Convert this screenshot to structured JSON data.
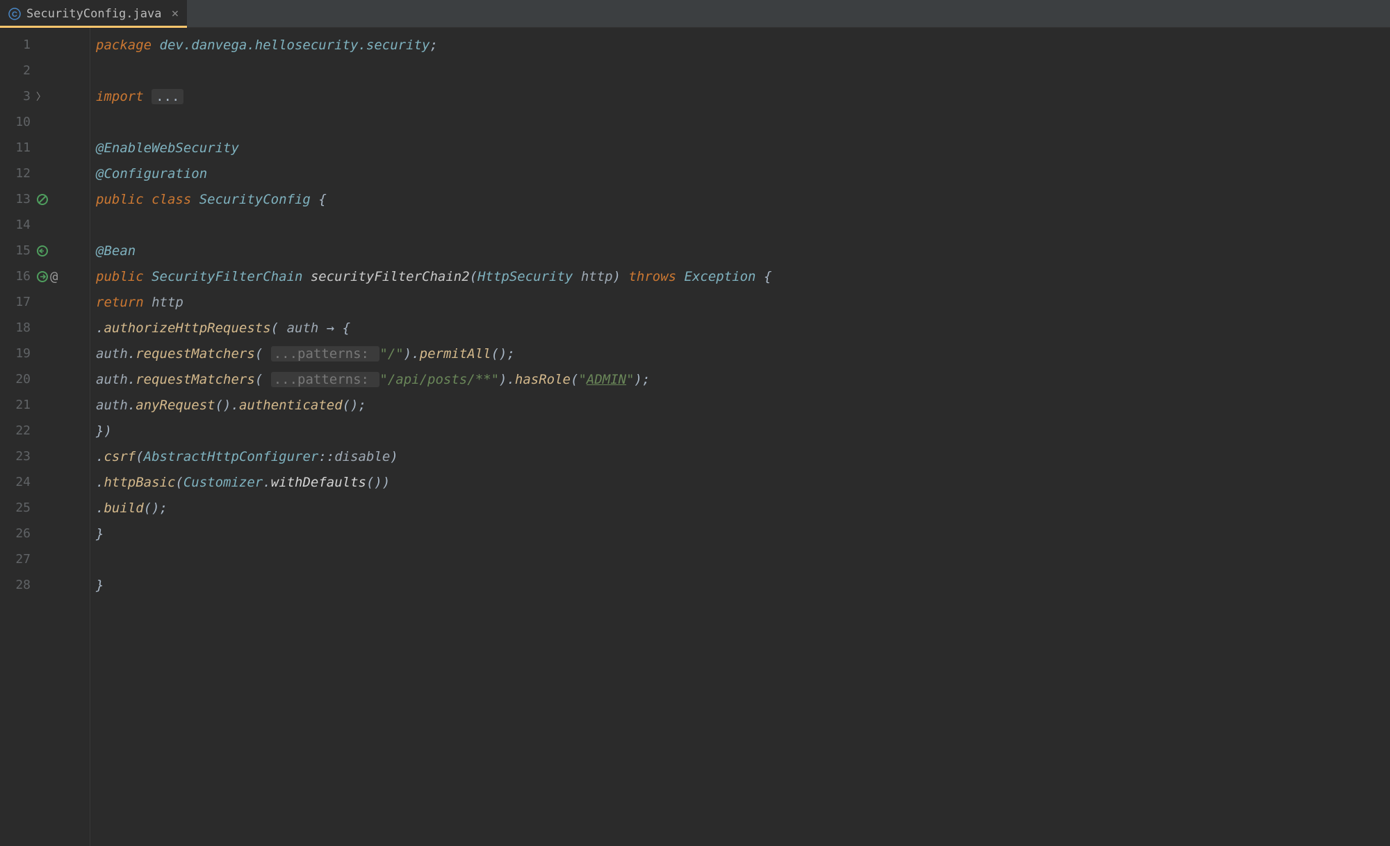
{
  "tab": {
    "label": "SecurityConfig.java",
    "close": "×"
  },
  "gutter": {
    "lines": [
      "1",
      "2",
      "3",
      "10",
      "11",
      "12",
      "13",
      "14",
      "15",
      "16",
      "17",
      "18",
      "19",
      "20",
      "21",
      "22",
      "23",
      "24",
      "25",
      "26",
      "27",
      "28"
    ]
  },
  "code": {
    "l1": {
      "kw_package": "package ",
      "pkg": "dev.danvega.hellosecurity.security",
      "semi": ";"
    },
    "l3": {
      "kw_import": "import ",
      "fold": "..."
    },
    "l11": {
      "ann": "@EnableWebSecurity"
    },
    "l12": {
      "ann": "@Configuration"
    },
    "l13": {
      "kw_public": "public ",
      "kw_class": "class ",
      "name": "SecurityConfig",
      "brace": " {"
    },
    "l15": {
      "ann": "@Bean"
    },
    "l16": {
      "kw_public": "public ",
      "type1": "SecurityFilterChain",
      "method": " securityFilterChain2",
      "lp": "(",
      "ptype": "HttpSecurity ",
      "pname": "http",
      "rp": ")",
      "throws": " throws ",
      "ex": "Exception",
      "brace": " {"
    },
    "l17": {
      "kw_return": "return ",
      "var": "http"
    },
    "l18": {
      "dot": ".",
      "m": "authorizeHttpRequests",
      "lp": "( ",
      "p": "auth",
      "arrow": " → {",
      "end": ""
    },
    "l19": {
      "var": "auth",
      "d1": ".",
      "m1": "requestMatchers",
      "lp": "( ",
      "hint": "...patterns: ",
      "s": "\"/\"",
      "rp": ").",
      "m2": "permitAll",
      "end": "();"
    },
    "l20": {
      "var": "auth",
      "d1": ".",
      "m1": "requestMatchers",
      "lp": "( ",
      "hint": "...patterns: ",
      "s": "\"/api/posts/**\"",
      "rp": ").",
      "m2": "hasRole",
      "lp2": "(",
      "s2a": "\"",
      "s2": "ADMIN",
      "s2b": "\"",
      "end": ");"
    },
    "l21": {
      "var": "auth",
      "d1": ".",
      "m1": "anyRequest",
      "p1": "().",
      "m2": "authenticated",
      "end": "();"
    },
    "l22": {
      "close": "})"
    },
    "l23": {
      "dot": ".",
      "m": "csrf",
      "lp": "(",
      "t": "AbstractHttpConfigurer",
      "cc": "::",
      "m2": "disable",
      "rp": ")"
    },
    "l24": {
      "dot": ".",
      "m": "httpBasic",
      "lp": "(",
      "t": "Customizer",
      "d": ".",
      "m2": "withDefaults",
      "end": "())"
    },
    "l25": {
      "dot": ".",
      "m": "build",
      "end": "();"
    },
    "l26": {
      "brace": "}"
    },
    "l28": {
      "brace": "}"
    }
  }
}
